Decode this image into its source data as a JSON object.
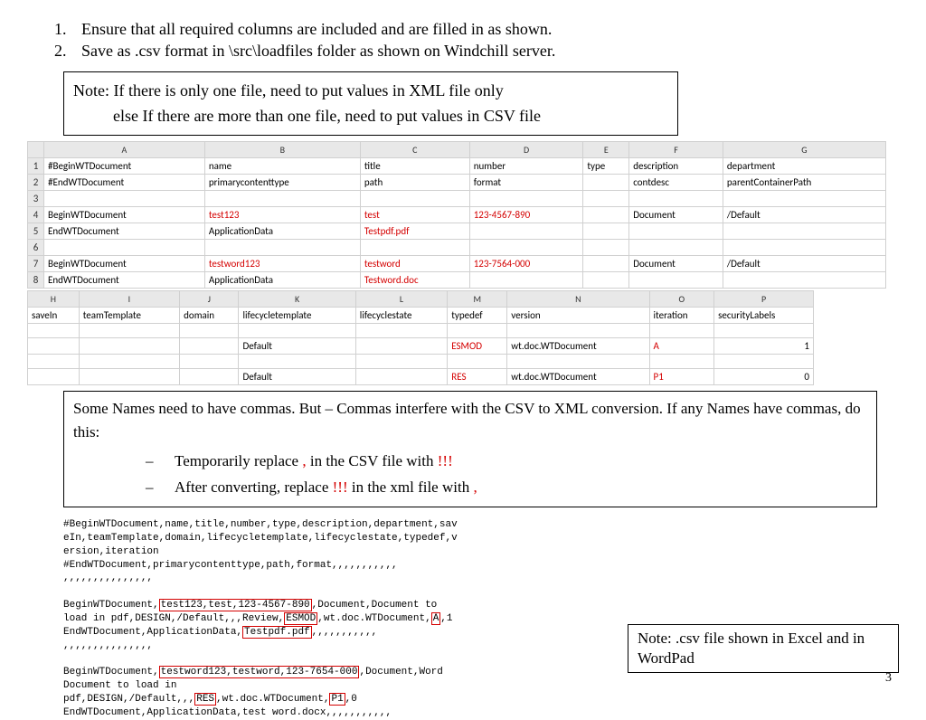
{
  "list": {
    "item1": "Ensure that all required columns are included and are filled in as shown.",
    "item2": "Save as .csv format in \\src\\loadfiles folder as shown on Windchill server."
  },
  "note1": {
    "line1": "Note: If there is only one file, need to put values in XML file only",
    "line2": "else If there are more than one file, need to put values in CSV file"
  },
  "sheet1": {
    "cols": [
      "A",
      "B",
      "C",
      "D",
      "E",
      "F",
      "G"
    ],
    "r1": [
      "#BeginWTDocument",
      "name",
      "title",
      "number",
      "type",
      "description",
      "department"
    ],
    "r2": [
      "#EndWTDocument",
      "primarycontenttype",
      "path",
      "format",
      "",
      "contdesc",
      "parentContainerPath"
    ],
    "r4": [
      "BeginWTDocument",
      "test123",
      "test",
      "123-4567-890",
      "",
      "Document",
      "/Default"
    ],
    "r5": [
      "EndWTDocument",
      "ApplicationData",
      "Testpdf.pdf",
      "",
      "",
      "",
      ""
    ],
    "r7": [
      "BeginWTDocument",
      "testword123",
      "testword",
      "123-7564-000",
      "",
      "Document",
      "/Default"
    ],
    "r8": [
      "EndWTDocument",
      "ApplicationData",
      "Testword.doc",
      "",
      "",
      "",
      ""
    ]
  },
  "sheet2": {
    "cols": [
      "H",
      "I",
      "J",
      "K",
      "L",
      "M",
      "N",
      "O",
      "P"
    ],
    "r1": [
      "saveIn",
      "teamTemplate",
      "domain",
      "lifecycletemplate",
      "lifecyclestate",
      "typedef",
      "version",
      "iteration",
      "securityLabels"
    ],
    "r2": [
      "",
      "",
      "",
      "Default",
      "",
      "ESMOD",
      "wt.doc.WTDocument",
      "A",
      "1"
    ],
    "r3": [
      "",
      "",
      "",
      "Default",
      "",
      "RES",
      "wt.doc.WTDocument",
      "P1",
      "0"
    ]
  },
  "note2": {
    "intro": "Some Names need to have commas.  But – Commas interfere with the CSV to XML conversion.  If any Names have commas, do this:",
    "s1a": "Temporarily replace ",
    "s1b": ",",
    "s1c": " in the CSV file with ",
    "s1d": "!!!",
    "s2a": "After converting, replace ",
    "s2b": "!!!",
    "s2c": " in the xml file with ",
    "s2d": ","
  },
  "mono": {
    "l1": "#BeginWTDocument,name,title,number,type,description,department,sav",
    "l2": "eIn,teamTemplate,domain,lifecycletemplate,lifecyclestate,typedef,v",
    "l3": "ersion,iteration",
    "l4": "#EndWTDocument,primarycontenttype,path,format,,,,,,,,,,,",
    "l5": ",,,,,,,,,,,,,,,",
    "b1a": "BeginWTDocument,",
    "b1b": "test123,test,123-4567-890",
    "b1c": ",Document,Document to",
    "b2a": "load in pdf,DESIGN,/Default,,,Review,",
    "b2b": "ESMOD",
    "b2c": ",wt.doc.WTDocument,",
    "b2d": "A",
    "b2e": ",1",
    "b3a": "EndWTDocument,ApplicationData,",
    "b3b": "Testpdf.pdf",
    "b3c": ",,,,,,,,,,,",
    "b4": ",,,,,,,,,,,,,,,",
    "c1a": "BeginWTDocument,",
    "c1b": "testword123,testword,123-7654-000",
    "c1c": ",Document,Word",
    "c2": "Document to load in",
    "c3a": "pdf,DESIGN,/Default,,,",
    "c3b": "RES",
    "c3c": ",wt.doc.WTDocument,",
    "c3d": "P1",
    "c3e": ",0",
    "c4": "EndWTDocument,ApplicationData,test word.docx,,,,,,,,,,,"
  },
  "bottom_note": "Note: .csv file shown in Excel and in WordPad",
  "pagenum": "3"
}
